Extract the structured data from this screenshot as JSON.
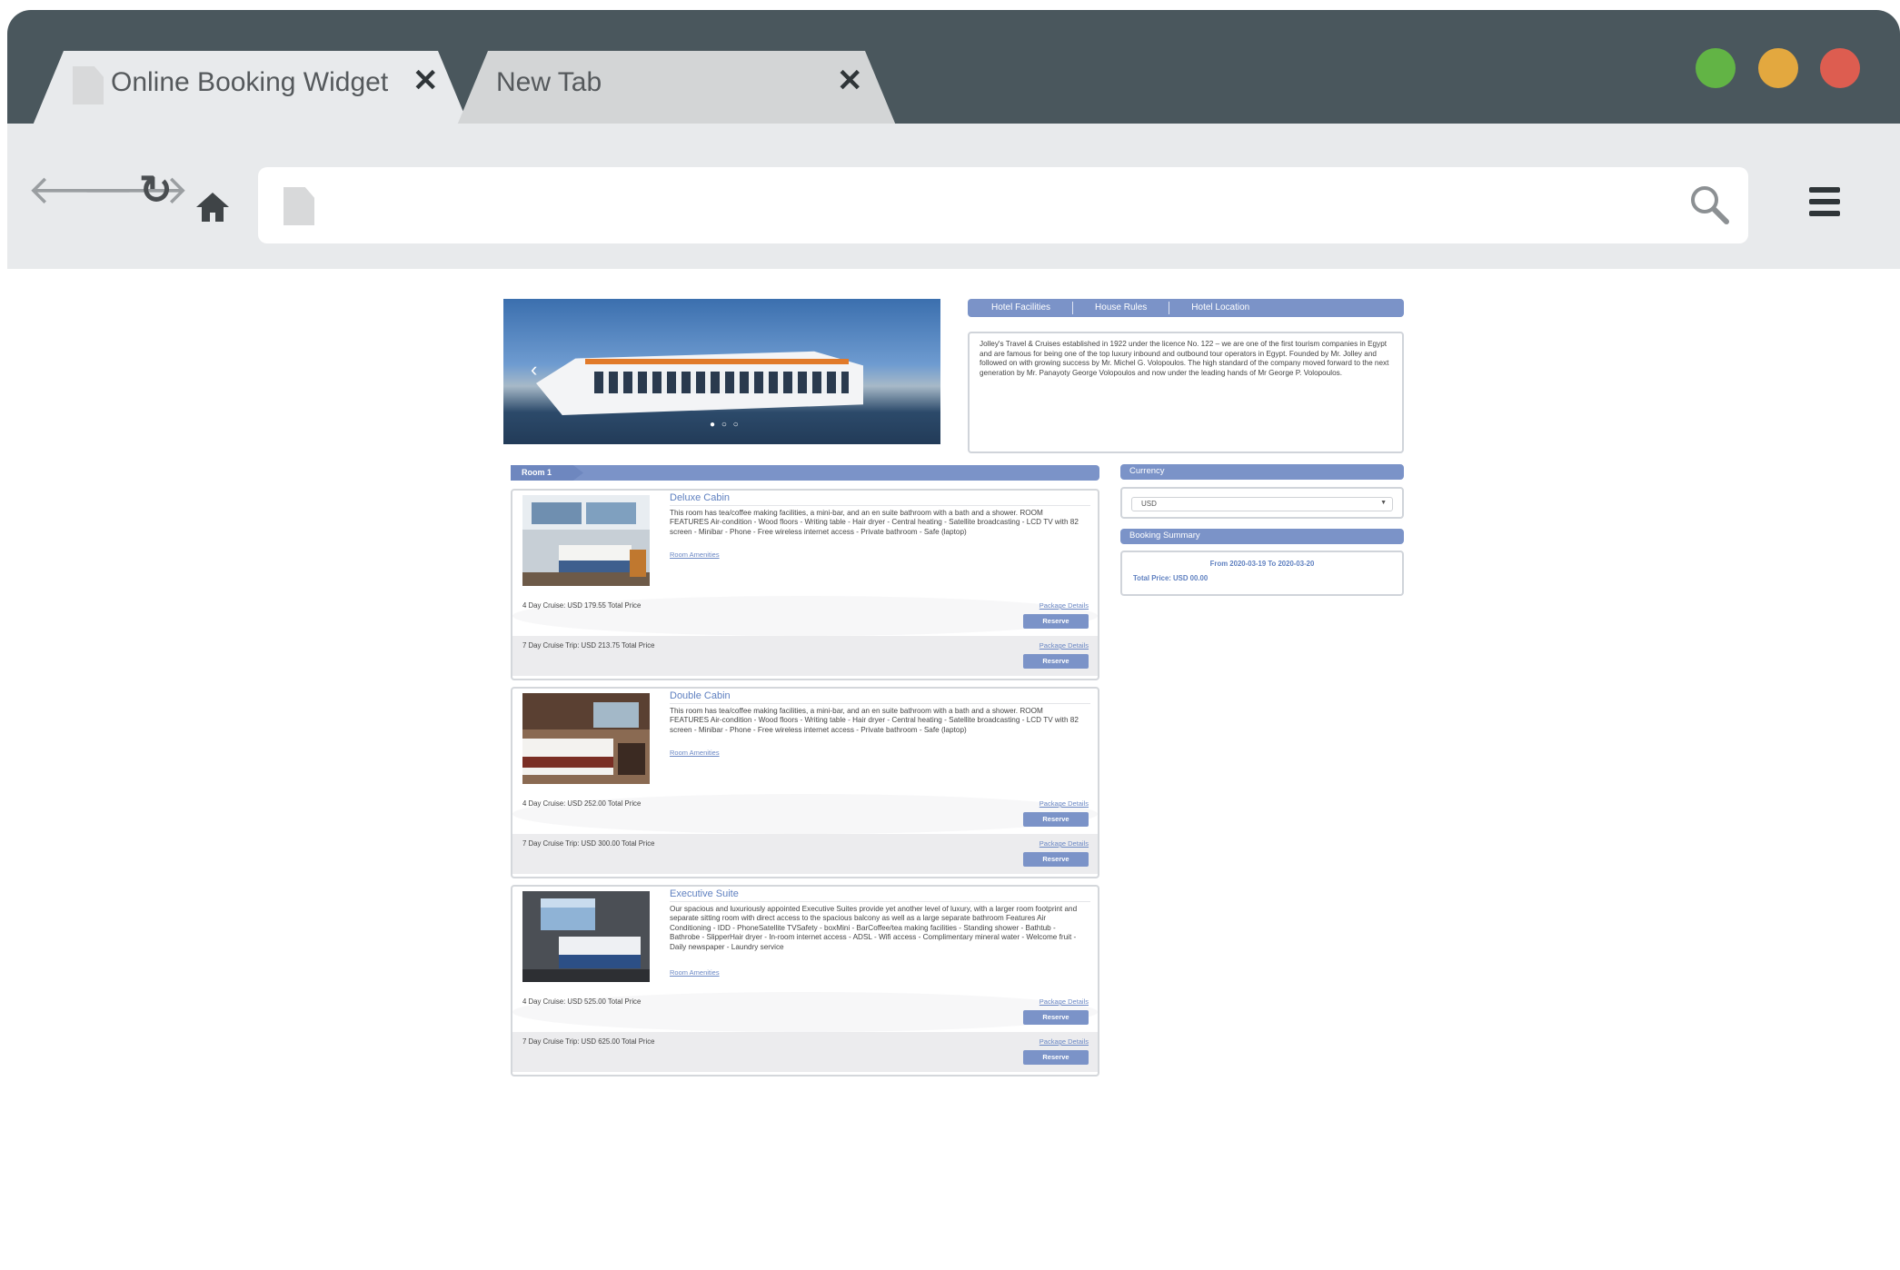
{
  "browser": {
    "tabs": [
      {
        "title": "Online Booking Widget",
        "active": true
      },
      {
        "title": "New Tab",
        "active": false
      }
    ],
    "close_glyph": "✕",
    "address": "",
    "colors": {
      "titlebar": "#4a575d",
      "toolbar": "#e8eaec",
      "green": "#62b445",
      "yellow": "#e3a83f",
      "red": "#dd5d50"
    }
  },
  "hotel": {
    "tabs": [
      "Hotel Facilities",
      "House Rules",
      "Hotel Location"
    ],
    "description": "Jolley's Travel & Cruises established in 1922 under the licence No. 122 – we are one of the first tourism companies in Egypt and are famous for being one of the top luxury inbound and outbound tour operators in Egypt. Founded by Mr. Jolley and followed on with growing success by Mr. Michel G. Volopoulos. The high standard of the company moved forward to the next generation by Mr. Panayoty George Volopoulos and now under the leading hands of Mr George P. Volopoulos.",
    "accent": "#7b93c8"
  },
  "room_section": {
    "label": "Room 1",
    "rooms": [
      {
        "name": "Deluxe Cabin",
        "description": "This room has tea/coffee making facilities, a mini-bar, and an en suite bathroom with a bath and a shower. ROOM FEATURES Air-condition - Wood floors - Writing table - Hair dryer - Central heating - Satellite broadcasting - LCD TV with 82 screen - Minibar - Phone - Free wireless internet access - Private bathroom - Safe (laptop)",
        "amenities_link": "Room Amenities",
        "options": [
          {
            "text": "4 Day Cruise: USD 179.55 Total Price",
            "details": "Package Details",
            "reserve": "Reserve"
          },
          {
            "text": "7 Day Cruise Trip: USD 213.75 Total Price",
            "details": "Package Details",
            "reserve": "Reserve"
          }
        ]
      },
      {
        "name": "Double Cabin",
        "description": "This room has tea/coffee making facilities, a mini-bar, and an en suite bathroom with a bath and a shower. ROOM FEATURES Air-condition - Wood floors - Writing table - Hair dryer - Central heating - Satellite broadcasting - LCD TV with 82 screen - Minibar - Phone - Free wireless internet access - Private bathroom - Safe (laptop)",
        "amenities_link": "Room Amenities",
        "options": [
          {
            "text": "4 Day Cruise: USD 252.00 Total Price",
            "details": "Package Details",
            "reserve": "Reserve"
          },
          {
            "text": "7 Day Cruise Trip: USD 300.00 Total Price",
            "details": "Package Details",
            "reserve": "Reserve"
          }
        ]
      },
      {
        "name": "Executive Suite",
        "description": "Our spacious and luxuriously appointed Executive Suites provide yet another level of luxury, with a larger room footprint and separate sitting room with direct access to the spacious balcony as well as a large separate bathroom Features Air Conditioning - IDD - PhoneSatellite TVSafety - boxMini - BarCoffee/tea making facilities - Standing shower - Bathtub - Bathrobe - SlipperHair dryer - In-room internet access - ADSL - Wifi access - Complimentary mineral water - Welcome fruit - Daily newspaper - Laundry service",
        "amenities_link": "Room Amenities",
        "options": [
          {
            "text": "4 Day Cruise: USD 525.00 Total Price",
            "details": "Package Details",
            "reserve": "Reserve"
          },
          {
            "text": "7 Day Cruise Trip: USD 625.00 Total Price",
            "details": "Package Details",
            "reserve": "Reserve"
          }
        ]
      }
    ]
  },
  "currency": {
    "heading": "Currency",
    "selected": "USD"
  },
  "summary": {
    "heading": "Booking Summary",
    "dates": "From 2020-03-19 To 2020-03-20",
    "total": "Total Price: USD 00.00"
  }
}
